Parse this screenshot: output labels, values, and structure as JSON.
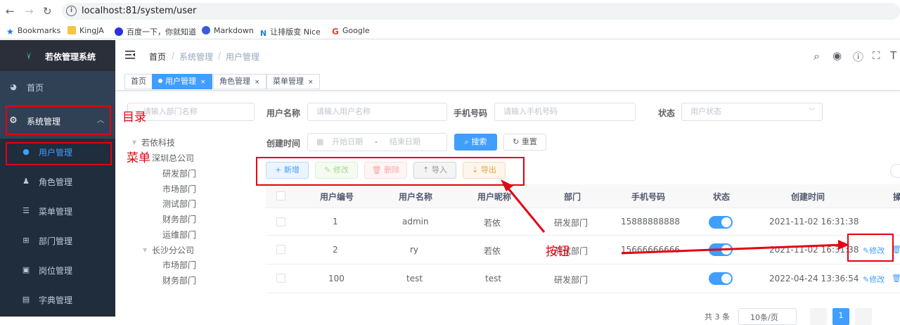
{
  "browser": {
    "url": "localhost:81/system/user",
    "bookmarks": [
      "Bookmarks",
      "KingJA",
      "百度一下，你就知道",
      "Markdown",
      "让排版变 Nice",
      "Google"
    ]
  },
  "sidebar": {
    "title": "若依管理系统",
    "items": [
      {
        "label": "首页"
      },
      {
        "label": "系统管理"
      },
      {
        "label": "用户管理"
      },
      {
        "label": "角色管理"
      },
      {
        "label": "菜单管理"
      },
      {
        "label": "部门管理"
      },
      {
        "label": "岗位管理"
      },
      {
        "label": "字典管理"
      }
    ]
  },
  "breadcrumb": [
    "首页",
    "系统管理",
    "用户管理"
  ],
  "tags": [
    "首页",
    "用户管理",
    "角色管理",
    "菜单管理"
  ],
  "search": {
    "dept_placeholder": "请输入部门名称",
    "username_label": "用户名称",
    "username_placeholder": "请输入用户名称",
    "phone_label": "手机号码",
    "phone_placeholder": "请输入手机号码",
    "status_label": "状态",
    "status_placeholder": "用户状态",
    "time_label": "创建时间",
    "start_placeholder": "开始日期",
    "range_sep": "-",
    "end_placeholder": "结束日期",
    "search_btn": "搜索",
    "reset_btn": "重置"
  },
  "toolbar": {
    "add": "新增",
    "edit": "修改",
    "delete": "删除",
    "import": "导入",
    "export": "导出"
  },
  "tree": {
    "root": "若依科技",
    "sz": "深圳总公司",
    "sz_children": [
      "研发部门",
      "市场部门",
      "测试部门",
      "财务部门",
      "运维部门"
    ],
    "cs": "长沙分公司",
    "cs_children": [
      "市场部门",
      "财务部门"
    ]
  },
  "table": {
    "headers": [
      "用户编号",
      "用户名称",
      "用户昵称",
      "部门",
      "手机号码",
      "状态",
      "创建时间",
      "操"
    ],
    "rows": [
      {
        "id": "1",
        "name": "admin",
        "nick": "若依",
        "dept": "研发部门",
        "phone": "15888888888",
        "status": true,
        "time": "2021-11-02 16:31:38"
      },
      {
        "id": "2",
        "name": "ry",
        "nick": "若依",
        "dept": "测试部门",
        "phone": "15666666666",
        "status": true,
        "time": "2021-11-02 16:31:38"
      },
      {
        "id": "100",
        "name": "test",
        "nick": "test",
        "dept": "研发部门",
        "phone": "",
        "status": true,
        "time": "2022-04-24 13:36:54"
      }
    ],
    "edit_link": "修改"
  },
  "pagination": {
    "total": "共 3 条",
    "page_size": "10条/页",
    "current": "1"
  },
  "annotations": {
    "catalog": "目录",
    "menu": "菜单",
    "button": "按钮"
  },
  "colors": {
    "accent": "#409eff",
    "sidebar": "#304156",
    "annotation": "#e60012"
  }
}
